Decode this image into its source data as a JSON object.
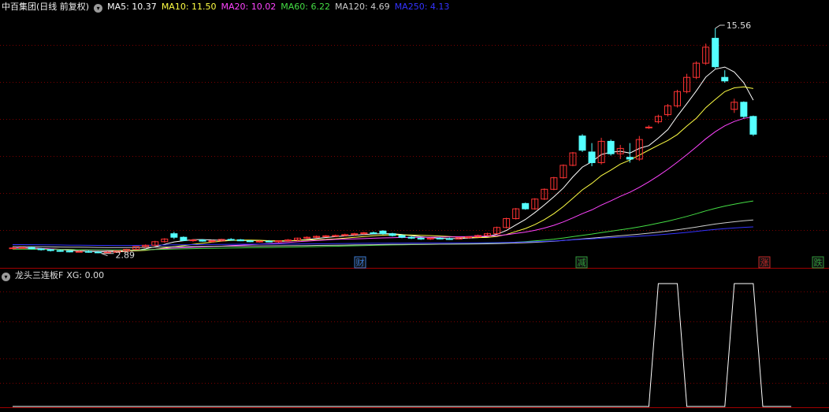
{
  "main_header": {
    "title": "中百集团(日线 前复权)",
    "indicators": [
      {
        "label": "MA5: 10.37",
        "color": "#ffffff"
      },
      {
        "label": "MA10: 11.50",
        "color": "#ffff44"
      },
      {
        "label": "MA20: 10.02",
        "color": "#ff44ff"
      },
      {
        "label": "MA60: 6.22",
        "color": "#44dd44"
      },
      {
        "label": "MA120: 4.69",
        "color": "#cccccc"
      },
      {
        "label": "MA250: 4.13",
        "color": "#3333ff"
      }
    ]
  },
  "sub_header": {
    "title": "龙头三连板F",
    "value_label": "XG: 0.00"
  },
  "events": [
    {
      "label": "财",
      "color": "#3a7bd5"
    },
    {
      "label": "减",
      "color": "#2f9a3a"
    },
    {
      "label": "涨",
      "color": "#c62828"
    },
    {
      "label": "跌",
      "color": "#2f9a3a"
    }
  ],
  "chart_data": [
    {
      "type": "candlestick",
      "title": "中百集团(日线 前复权)",
      "high_label": "15.56",
      "low_label": "2.89",
      "colors": {
        "up": "#ff3333",
        "down": "#54ffff",
        "grid": "#7a0000"
      },
      "candles": [
        [
          3.2,
          3.25,
          3.15,
          3.2
        ],
        [
          3.2,
          3.28,
          3.18,
          3.22
        ],
        [
          3.22,
          3.25,
          3.12,
          3.15
        ],
        [
          3.15,
          3.2,
          3.05,
          3.1
        ],
        [
          3.1,
          3.15,
          3.0,
          3.05
        ],
        [
          3.05,
          3.1,
          2.98,
          3.02
        ],
        [
          3.02,
          3.08,
          2.95,
          3.0
        ],
        [
          3.0,
          3.05,
          2.95,
          3.0
        ],
        [
          3.0,
          3.06,
          2.93,
          2.97
        ],
        [
          2.97,
          3.02,
          2.9,
          2.95
        ],
        [
          2.95,
          3.0,
          2.89,
          2.95
        ],
        [
          2.95,
          3.05,
          2.93,
          3.03
        ],
        [
          3.03,
          3.15,
          3.0,
          3.12
        ],
        [
          3.12,
          3.3,
          3.1,
          3.28
        ],
        [
          3.28,
          3.4,
          3.2,
          3.35
        ],
        [
          3.35,
          3.6,
          3.3,
          3.55
        ],
        [
          3.55,
          3.75,
          3.5,
          3.7
        ],
        [
          4.0,
          4.1,
          3.7,
          3.8
        ],
        [
          3.8,
          3.85,
          3.6,
          3.62
        ],
        [
          3.62,
          3.7,
          3.55,
          3.65
        ],
        [
          3.65,
          3.7,
          3.55,
          3.58
        ],
        [
          3.58,
          3.65,
          3.5,
          3.6
        ],
        [
          3.6,
          3.72,
          3.55,
          3.68
        ],
        [
          3.68,
          3.75,
          3.62,
          3.66
        ],
        [
          3.66,
          3.7,
          3.58,
          3.6
        ],
        [
          3.6,
          3.65,
          3.52,
          3.55
        ],
        [
          3.55,
          3.62,
          3.5,
          3.58
        ],
        [
          3.58,
          3.64,
          3.52,
          3.56
        ],
        [
          3.56,
          3.62,
          3.5,
          3.6
        ],
        [
          3.6,
          3.7,
          3.55,
          3.65
        ],
        [
          3.65,
          3.78,
          3.6,
          3.75
        ],
        [
          3.75,
          3.85,
          3.7,
          3.8
        ],
        [
          3.8,
          3.9,
          3.75,
          3.85
        ],
        [
          3.85,
          3.92,
          3.8,
          3.88
        ],
        [
          3.88,
          3.95,
          3.82,
          3.9
        ],
        [
          3.9,
          4.0,
          3.85,
          3.95
        ],
        [
          3.95,
          4.05,
          3.88,
          4.0
        ],
        [
          4.0,
          4.1,
          3.95,
          4.05
        ],
        [
          4.05,
          4.12,
          3.98,
          4.02
        ],
        [
          4.15,
          4.2,
          3.95,
          4.0
        ],
        [
          4.0,
          4.05,
          3.85,
          3.9
        ],
        [
          3.9,
          3.95,
          3.75,
          3.8
        ],
        [
          3.8,
          3.85,
          3.7,
          3.75
        ],
        [
          3.75,
          3.8,
          3.65,
          3.7
        ],
        [
          3.7,
          3.78,
          3.65,
          3.75
        ],
        [
          3.75,
          3.8,
          3.68,
          3.72
        ],
        [
          3.72,
          3.78,
          3.65,
          3.7
        ],
        [
          3.7,
          3.8,
          3.68,
          3.78
        ],
        [
          3.78,
          3.85,
          3.72,
          3.82
        ],
        [
          3.82,
          3.95,
          3.8,
          3.9
        ],
        [
          3.9,
          4.05,
          3.88,
          4.0
        ],
        [
          4.0,
          4.4,
          3.98,
          4.35
        ],
        [
          4.35,
          4.9,
          4.3,
          4.85
        ],
        [
          4.85,
          5.45,
          4.8,
          5.4
        ],
        [
          5.7,
          5.75,
          5.35,
          5.4
        ],
        [
          5.4,
          6.0,
          5.35,
          5.95
        ],
        [
          5.95,
          6.55,
          5.9,
          6.5
        ],
        [
          6.5,
          7.2,
          6.45,
          7.15
        ],
        [
          7.15,
          7.9,
          7.1,
          7.85
        ],
        [
          7.85,
          8.6,
          7.8,
          8.55
        ],
        [
          9.5,
          9.6,
          8.6,
          8.7
        ],
        [
          8.6,
          9.1,
          7.8,
          8.0
        ],
        [
          8.0,
          9.4,
          7.9,
          9.2
        ],
        [
          9.2,
          9.3,
          8.4,
          8.5
        ],
        [
          8.5,
          9.0,
          8.2,
          8.8
        ],
        [
          8.3,
          9.1,
          8.0,
          8.2
        ],
        [
          8.2,
          9.5,
          8.1,
          9.3
        ],
        [
          10.0,
          10.1,
          9.9,
          10.0
        ],
        [
          10.3,
          10.7,
          10.2,
          10.6
        ],
        [
          10.7,
          11.3,
          10.6,
          11.2
        ],
        [
          11.2,
          12.1,
          11.1,
          12.0
        ],
        [
          12.0,
          13.0,
          11.9,
          12.8
        ],
        [
          12.8,
          13.7,
          12.7,
          13.6
        ],
        [
          13.6,
          14.7,
          13.5,
          14.5
        ],
        [
          15.0,
          15.56,
          13.3,
          13.4
        ],
        [
          12.8,
          13.2,
          12.5,
          12.6
        ],
        [
          11.0,
          11.6,
          10.8,
          11.4
        ],
        [
          11.4,
          11.45,
          10.5,
          10.6
        ],
        [
          10.6,
          10.65,
          9.5,
          9.6
        ]
      ],
      "series": [
        {
          "name": "MA5",
          "color": "#ffffff",
          "last": 10.37
        },
        {
          "name": "MA10",
          "color": "#ffff44",
          "last": 11.5
        },
        {
          "name": "MA20",
          "color": "#ff44ff",
          "last": 10.02
        },
        {
          "name": "MA60",
          "color": "#44dd44",
          "last": 6.22
        },
        {
          "name": "MA120",
          "color": "#cccccc",
          "last": 4.69
        },
        {
          "name": "MA250",
          "color": "#3333ff",
          "last": 4.13
        }
      ]
    },
    {
      "type": "line",
      "title": "龙头三连板F",
      "series_name": "XG",
      "color": "#ffffff",
      "values": [
        0,
        0,
        0,
        0,
        0,
        0,
        0,
        0,
        0,
        0,
        0,
        0,
        0,
        0,
        0,
        0,
        0,
        0,
        0,
        0,
        0,
        0,
        0,
        0,
        0,
        0,
        0,
        0,
        0,
        0,
        0,
        0,
        0,
        0,
        0,
        0,
        0,
        0,
        0,
        0,
        0,
        0,
        0,
        0,
        0,
        0,
        0,
        0,
        0,
        0,
        0,
        0,
        0,
        0,
        0,
        0,
        0,
        0,
        0,
        0,
        0,
        0,
        0,
        0,
        0,
        0,
        0,
        0,
        1,
        1,
        1,
        0,
        0,
        0,
        0,
        0,
        1,
        1,
        1,
        0,
        0,
        0,
        0
      ]
    }
  ]
}
